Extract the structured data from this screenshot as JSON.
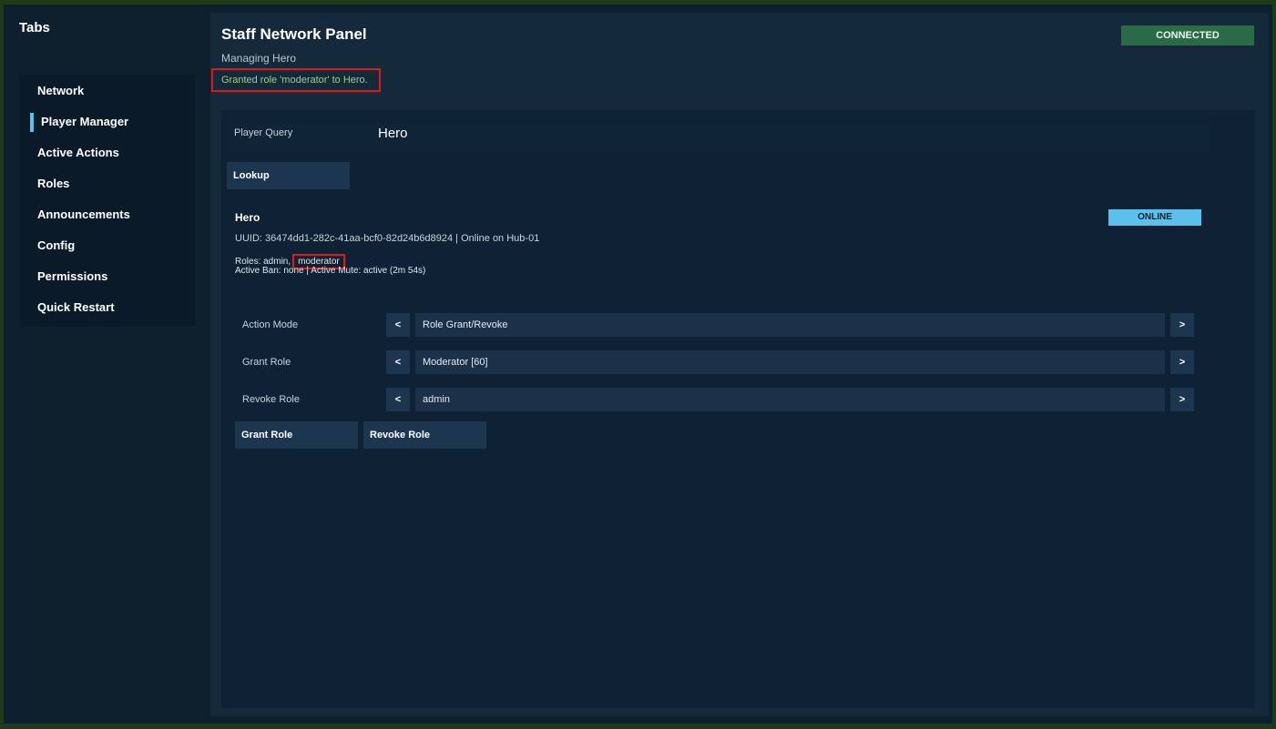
{
  "sidebar": {
    "title": "Tabs",
    "items": [
      {
        "label": "Network"
      },
      {
        "label": "Player Manager"
      },
      {
        "label": "Active Actions"
      },
      {
        "label": "Roles"
      },
      {
        "label": "Announcements"
      },
      {
        "label": "Config"
      },
      {
        "label": "Permissions"
      },
      {
        "label": "Quick Restart"
      }
    ],
    "active_index": 1
  },
  "header": {
    "title": "Staff Network Panel",
    "subtitle": "Managing Hero",
    "status_message": "Granted role 'moderator' to Hero.",
    "connection_status": "CONNECTED"
  },
  "query": {
    "label": "Player Query",
    "value": "Hero",
    "lookup_label": "Lookup"
  },
  "player": {
    "name": "Hero",
    "status": "ONLINE",
    "uuid_line": "UUID: 36474dd1-282c-41aa-bcf0-82d24b6d8924 | Online on Hub-01",
    "roles_prefix": "Roles: admin,",
    "roles_new": "moderator",
    "ban_mute_line": "Active Ban: none | Active Mute: active (2m 54s)"
  },
  "fields": [
    {
      "label": "Action Mode",
      "value": "Role Grant/Revoke"
    },
    {
      "label": "Grant Role",
      "value": "Moderator [60]"
    },
    {
      "label": "Revoke Role",
      "value": "admin"
    }
  ],
  "arrows": {
    "prev": "<",
    "next": ">"
  },
  "actions": {
    "grant_label": "Grant Role",
    "revoke_label": "Revoke Role"
  },
  "colors": {
    "accent": "#5bc0eb",
    "connected": "#2a6a45",
    "highlight": "#e01818",
    "success_text": "#9ccf8a"
  }
}
